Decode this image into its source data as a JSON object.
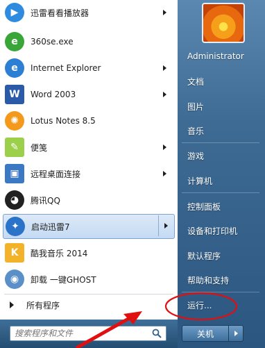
{
  "left": {
    "programs": [
      {
        "label": "迅雷看看播放器",
        "icon": "xunlei-kankan-icon",
        "color": "#2f8be0",
        "has_arrow": true
      },
      {
        "label": "360se.exe",
        "icon": "360se-icon",
        "color": "#3aa63a",
        "has_arrow": false
      },
      {
        "label": "Internet Explorer",
        "icon": "internet-explorer-icon",
        "color": "#2d7fd3",
        "has_arrow": true
      },
      {
        "label": "Word 2003",
        "icon": "word-icon",
        "color": "#2a5aa8",
        "has_arrow": true
      },
      {
        "label": "Lotus Notes 8.5",
        "icon": "lotus-notes-icon",
        "color": "#f39a1c",
        "has_arrow": false
      },
      {
        "label": "便笺",
        "icon": "sticky-notes-icon",
        "color": "#9ccf4a",
        "has_arrow": true
      },
      {
        "label": "远程桌面连接",
        "icon": "remote-desktop-icon",
        "color": "#3c79c4",
        "has_arrow": true
      },
      {
        "label": "腾讯QQ",
        "icon": "qq-penguin-icon",
        "color": "#222222",
        "has_arrow": false
      },
      {
        "label": "启动迅雷7",
        "icon": "xunlei-icon",
        "color": "#2a73c9",
        "has_arrow": true
      },
      {
        "label": "酷我音乐 2014",
        "icon": "kuwo-music-icon",
        "color": "#f2b32a",
        "has_arrow": false
      },
      {
        "label": "卸载 一键GHOST",
        "icon": "ghost-uninstall-icon",
        "color": "#5a8fc8",
        "has_arrow": false
      }
    ],
    "all_programs": "所有程序",
    "search_placeholder": "搜索程序和文件"
  },
  "right": {
    "items": [
      "Administrator",
      "文档",
      "图片",
      "音乐",
      "游戏",
      "计算机",
      "控制面板",
      "设备和打印机",
      "默认程序",
      "帮助和支持",
      "运行..."
    ],
    "shutdown": "关机"
  },
  "annotation": {
    "circle_color": "#e01010",
    "arrow_color": "#e01010"
  }
}
